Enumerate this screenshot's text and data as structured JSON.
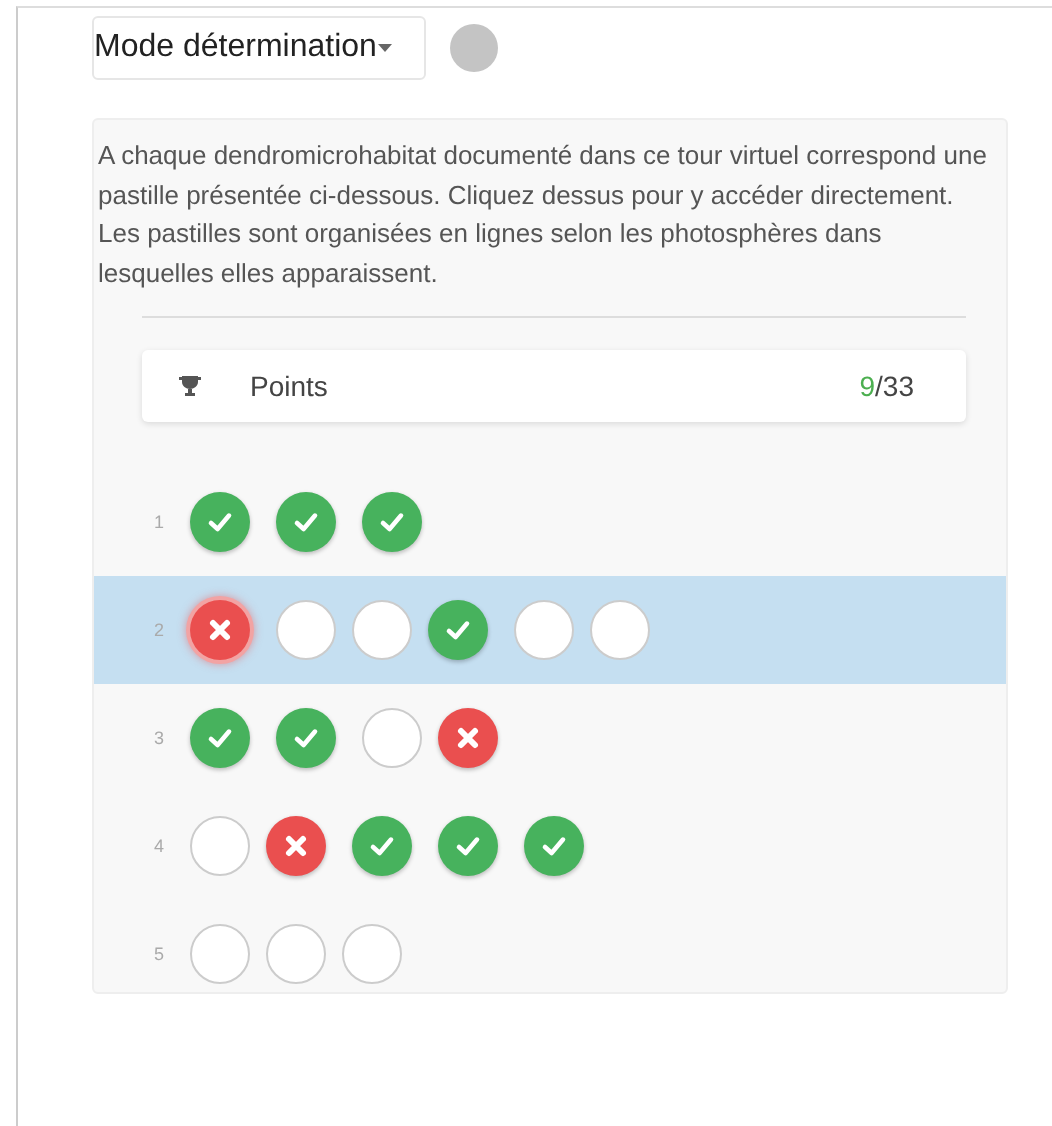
{
  "mode_dropdown": {
    "label": "Mode détermination"
  },
  "status_dot": {
    "color": "#c4c4c4"
  },
  "description": "A chaque dendromicrohabitat documenté dans ce tour virtuel correspond une pastille présentée ci-dessous. Cliquez dessus pour y accéder directement. Les pastilles sont organisées en lignes selon les photosphères dans lesquelles elles apparaissent.",
  "points": {
    "label": "Points",
    "score": "9",
    "total": "/33"
  },
  "rows": [
    {
      "number": "1",
      "selected": false,
      "pastilles": [
        {
          "kind": "correct",
          "selected": false
        },
        {
          "kind": "correct",
          "selected": false
        },
        {
          "kind": "correct",
          "selected": false
        }
      ]
    },
    {
      "number": "2",
      "selected": true,
      "pastilles": [
        {
          "kind": "wrong",
          "selected": true
        },
        {
          "kind": "empty",
          "selected": false
        },
        {
          "kind": "empty",
          "selected": false
        },
        {
          "kind": "correct",
          "selected": false
        },
        {
          "kind": "empty",
          "selected": false
        },
        {
          "kind": "empty",
          "selected": false
        }
      ]
    },
    {
      "number": "3",
      "selected": false,
      "pastilles": [
        {
          "kind": "correct",
          "selected": false
        },
        {
          "kind": "correct",
          "selected": false
        },
        {
          "kind": "empty",
          "selected": false
        },
        {
          "kind": "wrong",
          "selected": false
        }
      ]
    },
    {
      "number": "4",
      "selected": false,
      "pastilles": [
        {
          "kind": "empty",
          "selected": false
        },
        {
          "kind": "wrong",
          "selected": false
        },
        {
          "kind": "correct",
          "selected": false
        },
        {
          "kind": "correct",
          "selected": false
        },
        {
          "kind": "correct",
          "selected": false
        }
      ]
    },
    {
      "number": "5",
      "selected": false,
      "pastilles": [
        {
          "kind": "empty",
          "selected": false
        },
        {
          "kind": "empty",
          "selected": false
        },
        {
          "kind": "empty",
          "selected": false
        }
      ]
    }
  ]
}
